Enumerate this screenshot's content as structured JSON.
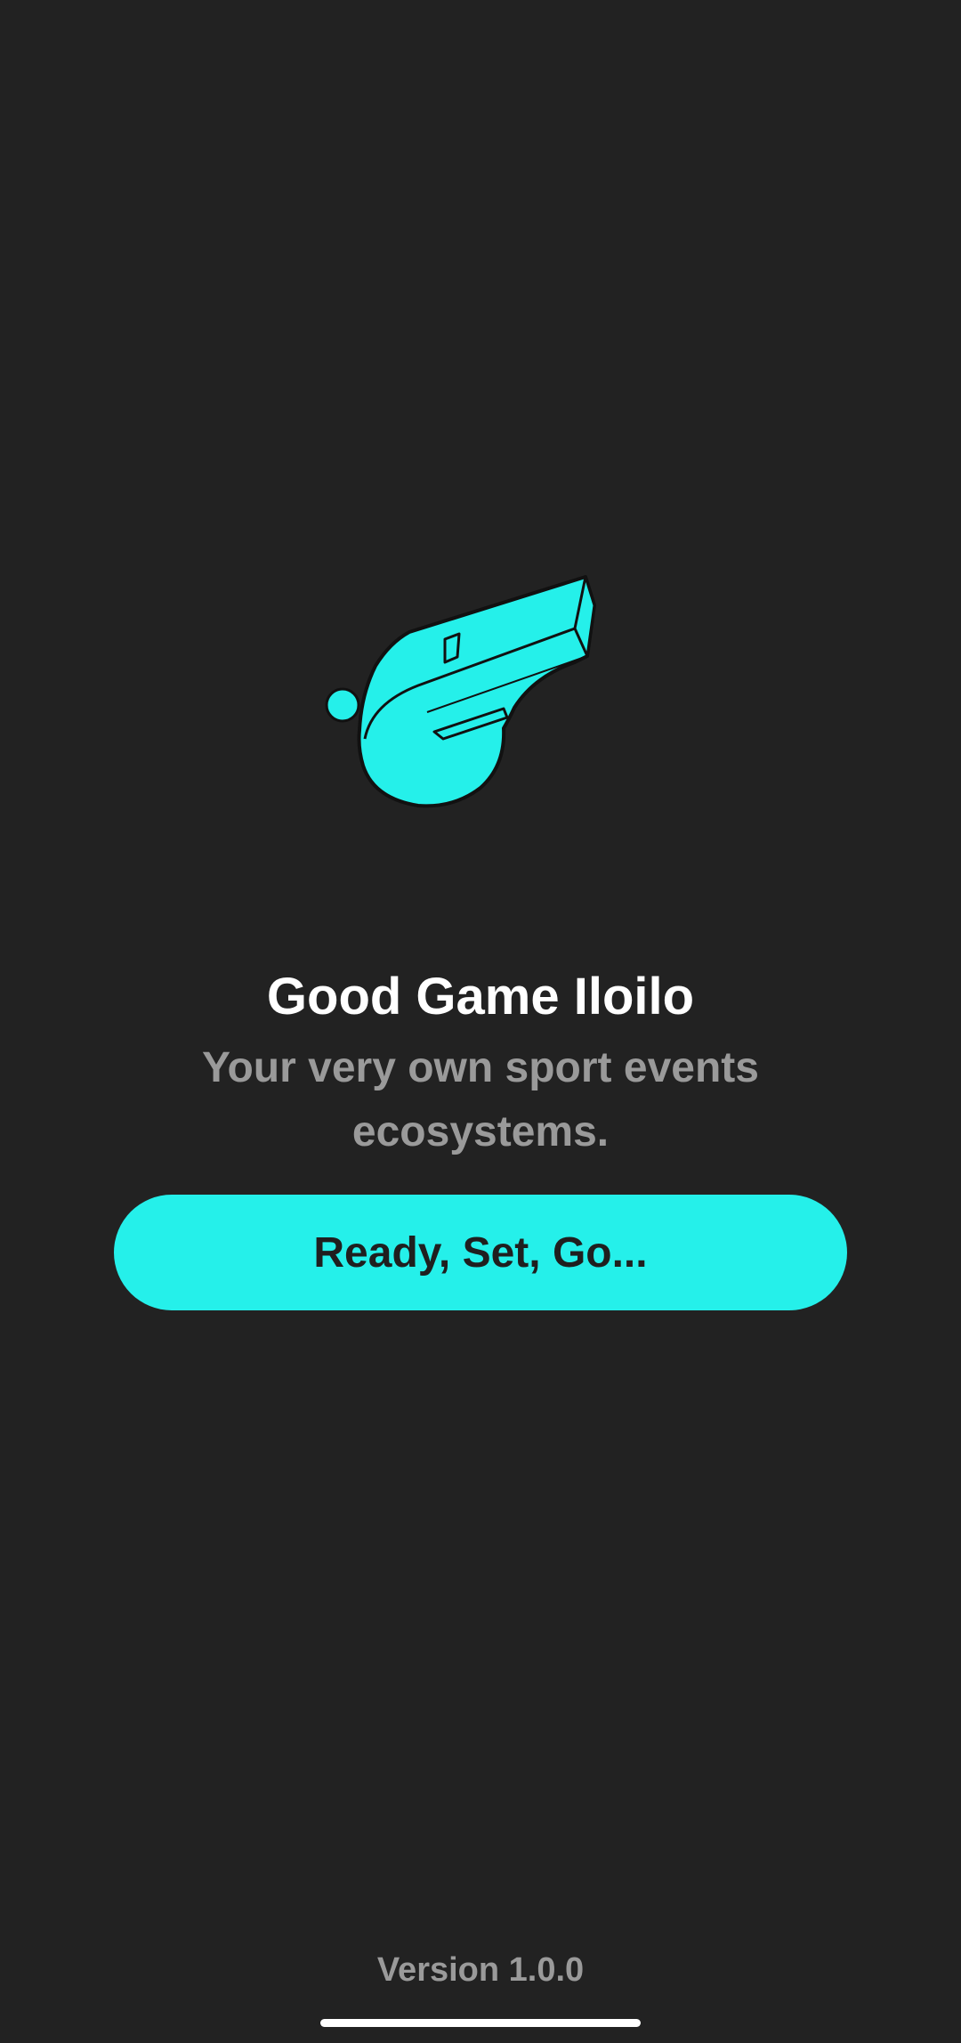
{
  "app": {
    "title": "Good Game Iloilo",
    "subtitle": "Your very own sport events ecosystems.",
    "cta_label": "Ready, Set, Go...",
    "version": "Version 1.0.0"
  },
  "icons": {
    "logo": "whistle-icon"
  },
  "colors": {
    "background": "#222222",
    "accent": "#25f0ea",
    "title_text": "#ffffff",
    "muted_text": "#9a9a9a",
    "button_text": "#1f1f1f"
  }
}
